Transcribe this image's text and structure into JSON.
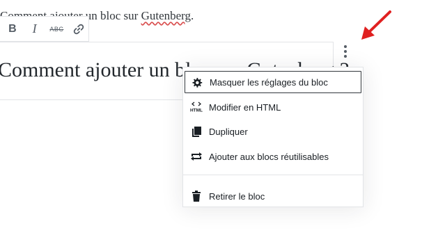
{
  "paragraph": {
    "prefix": "Comment ajouter un bloc sur ",
    "misspelled": "Gutenberg",
    "suffix": "."
  },
  "format_toolbar": {
    "bold_label": "B",
    "italic_label": "I",
    "strike_label": "ABC"
  },
  "heading": {
    "text": "Comment ajouter un bloc sur Gutenberg ?"
  },
  "menu": {
    "items": [
      {
        "label": "Masquer les réglages du bloc",
        "icon": "gear-icon"
      },
      {
        "label": "Modifier en HTML",
        "icon": "html-icon"
      },
      {
        "label": "Dupliquer",
        "icon": "copy-icon"
      },
      {
        "label": "Ajouter aux blocs réutilisables",
        "icon": "reusable-icon"
      },
      {
        "label": "Retirer le bloc",
        "icon": "trash-icon"
      }
    ],
    "html_icon_text": "HTML"
  },
  "colors": {
    "annotation_arrow": "#e02020",
    "focus_border": "#32373c"
  }
}
